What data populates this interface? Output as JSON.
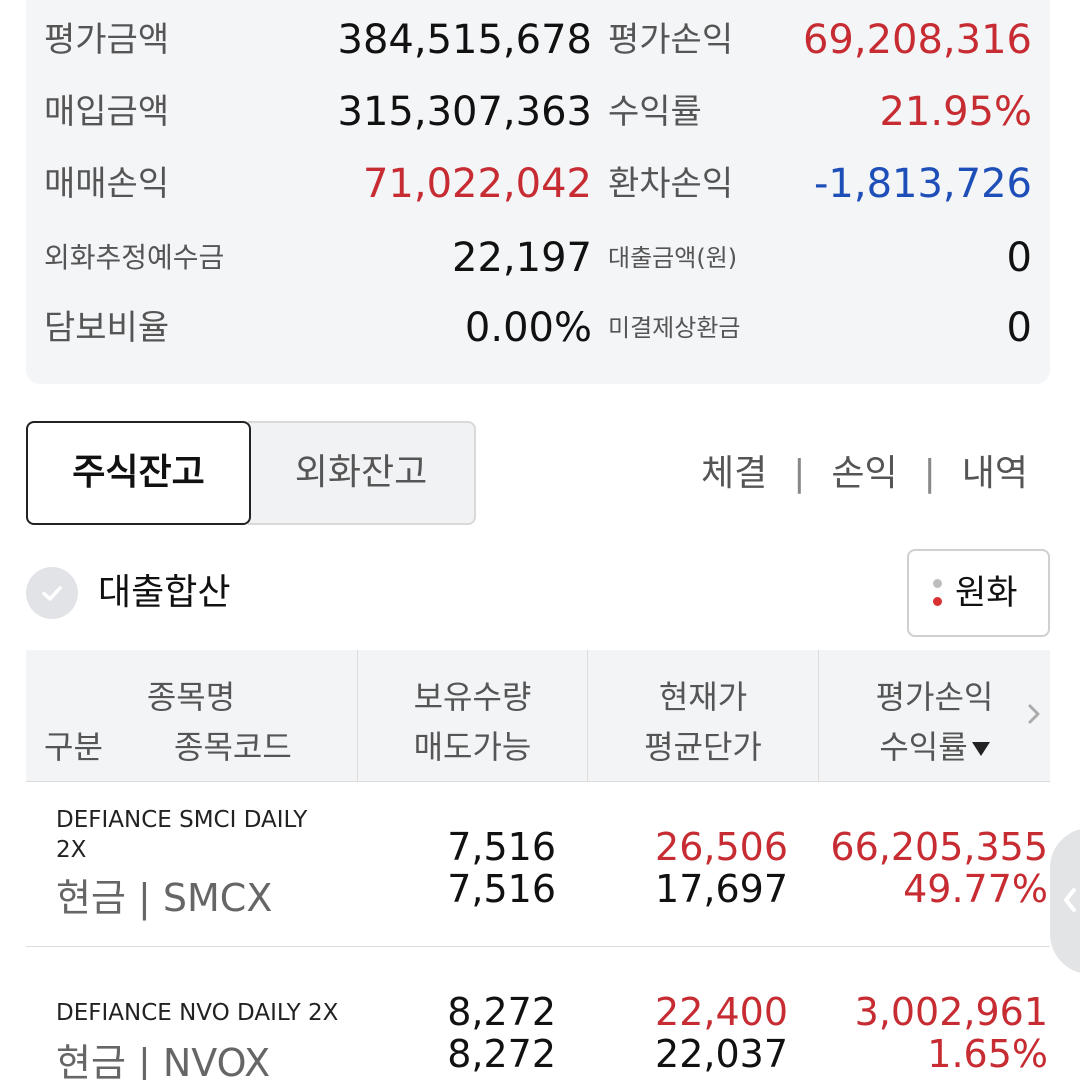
{
  "summary": {
    "rows": [
      {
        "label1": "평가금액",
        "value1": "384,515,678",
        "label2": "평가손익",
        "value2": "69,208,316"
      },
      {
        "label1": "매입금액",
        "value1": "315,307,363",
        "label2": "수익률",
        "value2": "21.95%"
      },
      {
        "label1": "매매손익",
        "value1": "71,022,042",
        "label2": "환차손익",
        "value2": "-1,813,726"
      },
      {
        "label1": "외화추정예수금",
        "value1": "22,197",
        "label2": "대출금액(원)",
        "value2": "0"
      },
      {
        "label1": "담보비율",
        "value1": "0.00%",
        "label2": "미결제상환금",
        "value2": "0"
      }
    ]
  },
  "tabs": {
    "stock": "주식잔고",
    "fx": "외화잔고"
  },
  "links": {
    "fills": "체결",
    "pnl": "손익",
    "history": "내역",
    "sep": "|"
  },
  "loan_toggle": {
    "label": "대출합산"
  },
  "currency_button": {
    "label": "원화"
  },
  "table": {
    "headers": {
      "col1_top": "종목명",
      "col1_left": "구분",
      "col1_right": "종목코드",
      "col2_top": "보유수량",
      "col2_bottom": "매도가능",
      "col3_top": "현재가",
      "col3_bottom": "평균단가",
      "col4_top": "평가손익",
      "col4_bottom": "수익률"
    },
    "rows": [
      {
        "name_line1": "DEFIANCE SMCI DAILY",
        "name_line2": "2X",
        "kind": "현금 | SMCX",
        "qty": "7,516",
        "sellable": "7,516",
        "price": "26,506",
        "avg": "17,697",
        "pnl": "66,205,355",
        "rate": "49.77%"
      },
      {
        "name_line1": "DEFIANCE NVO DAILY 2X",
        "name_line2": "",
        "kind": "현금 | NVOX",
        "qty": "8,272",
        "sellable": "8,272",
        "price": "22,400",
        "avg": "22,037",
        "pnl": "3,002,961",
        "rate": "1.65%"
      }
    ]
  },
  "colors": {
    "profit": "#c62c32",
    "loss": "#1e4fb8",
    "panel": "#f4f5f7"
  }
}
